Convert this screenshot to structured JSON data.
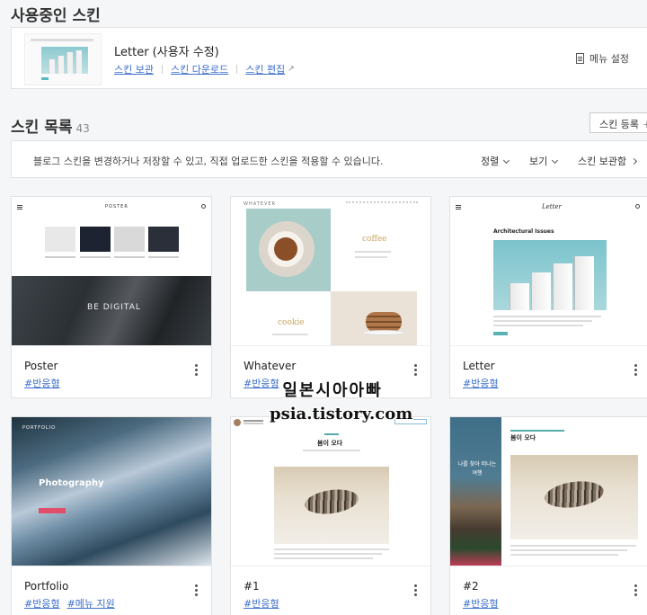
{
  "current_section": {
    "title": "사용중인 스킨",
    "skin_name": "Letter (사용자 수정)",
    "links": [
      "스킨 보관",
      "스킨 다운로드",
      "스킨 편집"
    ],
    "menu_setting": "메뉴 설정"
  },
  "list_section": {
    "title": "스킨 목록",
    "count": "43",
    "register_label": "스킨 등록",
    "info_text": "블로그 스킨을 변경하거나 저장할 수 있고, 직접 업로드한 스킨을 적용할 수 있습니다.",
    "sort_label": "정렬",
    "view_label": "보기",
    "archive_label": "스킨 보관함"
  },
  "skins": [
    {
      "name": "Poster",
      "tags": [
        "#반응형"
      ],
      "preview": {
        "logo": "POSTER",
        "banner": "BE DIGITAL"
      }
    },
    {
      "name": "Whatever",
      "tags": [
        "#반응형"
      ],
      "preview": {
        "logo": "WHATEVER",
        "word1": "coffee",
        "word2": "cookie"
      }
    },
    {
      "name": "Letter",
      "tags": [
        "#반응형"
      ],
      "preview": {
        "logo": "Letter",
        "title": "Architectural Issues"
      }
    },
    {
      "name": "Portfolio",
      "tags": [
        "#반응형",
        "#메뉴 지원"
      ],
      "preview": {
        "logo": "PORTFOLIO",
        "title": "Photography"
      }
    },
    {
      "name": "#1",
      "tags": [
        "#반응형"
      ],
      "preview": {
        "title": "봄이 오다"
      }
    },
    {
      "name": "#2",
      "tags": [
        "#반응형"
      ],
      "preview": {
        "title": "봄이 오다",
        "side_text": "나를 찾아 떠나는 여행"
      }
    }
  ],
  "watermark": {
    "line1": "일본시아아빠",
    "line2": "psia.tistory.com"
  }
}
